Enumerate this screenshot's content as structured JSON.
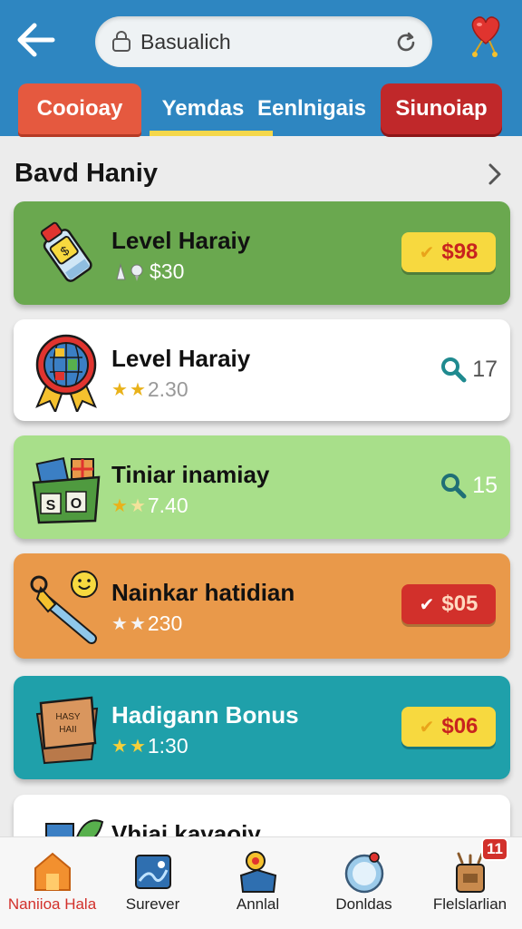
{
  "header": {
    "search": {
      "value": "Basualich"
    },
    "tabs": [
      {
        "label": "Cooioay"
      },
      {
        "label": "Yemdas"
      },
      {
        "label": "Eenlnigais"
      },
      {
        "label": "Siunoiap"
      }
    ]
  },
  "section": {
    "title": "Bavd Haniy"
  },
  "cards": [
    {
      "name": "Level Haraiy",
      "sub": "$30",
      "price": "$98",
      "price_style": "yellow"
    },
    {
      "name": "Level Haraiy",
      "rating_text": "2.30",
      "count": "17"
    },
    {
      "name": "Tiniar inamiay",
      "rating_text": "7.40",
      "count": "15"
    },
    {
      "name": "Nainkar hatidian",
      "rating_text": "230",
      "price": "$05",
      "price_style": "red"
    },
    {
      "name": "Hadigann Bonus",
      "rating_text": "1:30",
      "price": "$06",
      "price_style": "yellow"
    },
    {
      "name": "Vhiai kavaoiy"
    }
  ],
  "bottom_nav": {
    "items": [
      {
        "label": "Naniioa Hala",
        "icon": "home-icon",
        "active": true
      },
      {
        "label": "Surever",
        "icon": "map-icon",
        "active": false
      },
      {
        "label": "Annlal",
        "icon": "gift-box-icon",
        "active": false
      },
      {
        "label": "Donldas",
        "icon": "globe-icon",
        "active": false
      },
      {
        "label": "Flelslarlian",
        "icon": "backpack-icon",
        "active": false,
        "badge": "11"
      }
    ]
  },
  "colors": {
    "header": "#2e86c1",
    "accent_red": "#d2302b",
    "accent_yellow": "#f7d93f"
  }
}
